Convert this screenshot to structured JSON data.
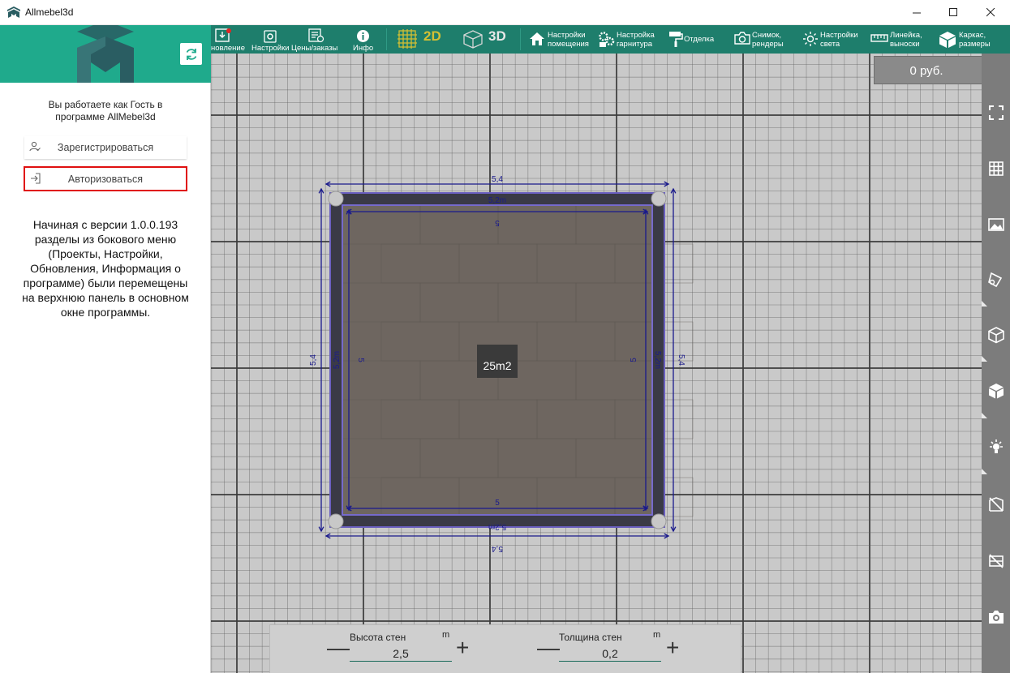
{
  "window": {
    "title": "Allmebel3d",
    "controls": [
      "minimize",
      "maximize",
      "close"
    ]
  },
  "sidebar": {
    "guest_note": "Вы работаете как Гость в программе AllMebel3d",
    "register_label": "Зарегистрироваться",
    "login_label": "Авторизоваться",
    "info_text": "Начиная с версии 1.0.0.193 разделы из бокового меню  (Проекты, Настройки, Обновления, Информация о программе) были перемещены на верхнюю панель в основном окне программы."
  },
  "toolbar": {
    "items": [
      {
        "icon": "download-icon",
        "label": "новление"
      },
      {
        "icon": "settings-icon",
        "label": "Настройки"
      },
      {
        "icon": "prices-icon",
        "label": "Цены/заказы"
      },
      {
        "icon": "info-icon",
        "label": "Инфо"
      },
      {
        "icon": "grid-2d-icon",
        "label": "2D"
      },
      {
        "icon": "cube-3d-icon",
        "label": "3D"
      },
      {
        "icon": "home-icon",
        "label": "Настройки помещения"
      },
      {
        "icon": "gears-icon",
        "label": "Настройка гарнитура"
      },
      {
        "icon": "paint-roller-icon",
        "label": "Отделка"
      },
      {
        "icon": "camera-icon",
        "label": "Снимок, рендеры"
      },
      {
        "icon": "light-icon",
        "label": "Настройки света"
      },
      {
        "icon": "ruler-icon",
        "label": "Линейка, выноски"
      },
      {
        "icon": "box-icon",
        "label": "Каркас, размеры"
      }
    ],
    "active_mode": "2D",
    "accent_color": "#d4c033"
  },
  "price": {
    "value": "0 руб."
  },
  "room": {
    "area_label": "25m2",
    "outer_dim": "5,4",
    "wall_dim": "5,2m",
    "inner_dim": "5",
    "floor_color": "#6e6660",
    "wall_color": "#3a3a46",
    "dim_color": "#1a1a8c"
  },
  "right_rail": {
    "icons": [
      "fullscreen-icon",
      "grid-icon",
      "image-icon",
      "texture-icon",
      "box-open-icon",
      "cube-icon",
      "lamp-icon",
      "hide-walls-icon",
      "hide-furniture-icon",
      "screenshot-icon"
    ]
  },
  "bottom_panel": {
    "wall_height": {
      "title": "Высота стен",
      "unit": "m",
      "value": "2,5"
    },
    "wall_thickness": {
      "title": "Толщина стен",
      "unit": "m",
      "value": "0,2"
    },
    "minus": "—",
    "plus": "+"
  }
}
